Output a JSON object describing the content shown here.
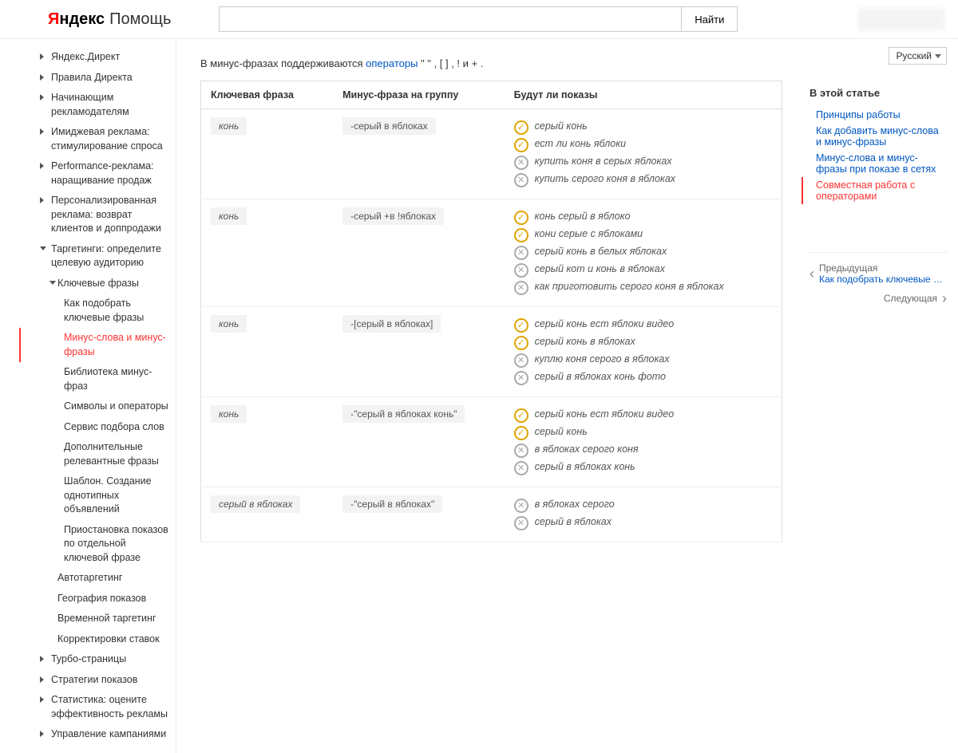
{
  "header": {
    "logo_red": "Я",
    "logo_rest": "ндекс",
    "logo_help": "Помощь",
    "search_placeholder": "",
    "search_button": "Найти"
  },
  "sidebar": {
    "items": [
      {
        "label": "Яндекс.Директ",
        "type": "top"
      },
      {
        "label": "Правила Директа",
        "type": "top"
      },
      {
        "label": "Начинающим рекламодателям",
        "type": "top"
      },
      {
        "label": "Имиджевая реклама: стимулирование спроса",
        "type": "top"
      },
      {
        "label": "Performance-реклама: наращивание продаж",
        "type": "top"
      },
      {
        "label": "Персонализированная реклама: возврат клиентов и доппродажи",
        "type": "top"
      },
      {
        "label": "Таргетинги: определите целевую аудиторию",
        "type": "top",
        "open": true,
        "children": [
          {
            "label": "Ключевые фразы",
            "type": "top",
            "open": true,
            "children2": [
              {
                "label": "Как подобрать ключевые фразы"
              },
              {
                "label": "Минус-слова и минус-фразы",
                "active": true
              },
              {
                "label": "Библиотека минус-фраз"
              },
              {
                "label": "Символы и операторы"
              },
              {
                "label": "Сервис подбора слов"
              },
              {
                "label": "Дополнительные релевантные фразы"
              },
              {
                "label": "Шаблон. Создание однотипных объявлений"
              },
              {
                "label": "Приостановка показов по отдельной ключевой фразе"
              }
            ]
          },
          {
            "label": "Автотаргетинг"
          },
          {
            "label": "География показов"
          },
          {
            "label": "Временной таргетинг"
          },
          {
            "label": "Корректировки ставок"
          }
        ]
      },
      {
        "label": "Турбо-страницы",
        "type": "top"
      },
      {
        "label": "Стратегии показов",
        "type": "top"
      },
      {
        "label": "Статистика: оцените эффективность рекламы",
        "type": "top"
      },
      {
        "label": "Управление кампаниями",
        "type": "top"
      }
    ]
  },
  "content": {
    "intro_prefix": "В минус-фразах поддерживаются ",
    "intro_link": "операторы",
    "intro_suffix": " \" \" , [ ] , ! и + .",
    "table": {
      "headers": [
        "Ключевая фраза",
        "Минус-фраза на группу",
        "Будут ли показы"
      ],
      "rows": [
        {
          "key": "конь",
          "minus": "-серый в яблоках",
          "results": [
            {
              "ok": true,
              "text": "серый конь"
            },
            {
              "ok": true,
              "text": "ест ли конь яблоки"
            },
            {
              "ok": false,
              "text": "купить коня в серых яблоках"
            },
            {
              "ok": false,
              "text": "купить серого коня в яблоках"
            }
          ]
        },
        {
          "key": "конь",
          "minus": "-серый +в !яблоках",
          "results": [
            {
              "ok": true,
              "text": "конь серый в яблоко"
            },
            {
              "ok": true,
              "text": "кони серые с яблоками"
            },
            {
              "ok": false,
              "text": "серый конь в белых яблоках"
            },
            {
              "ok": false,
              "text": "серый кот и конь в яблоках"
            },
            {
              "ok": false,
              "text": "как приготовить серого коня в яблоках"
            }
          ]
        },
        {
          "key": "конь",
          "minus": "-[серый в яблоках]",
          "results": [
            {
              "ok": true,
              "text": "серый конь ест яблоки видео"
            },
            {
              "ok": true,
              "text": "серый конь в яблоках"
            },
            {
              "ok": false,
              "text": "куплю коня серого в яблоках"
            },
            {
              "ok": false,
              "text": "серый в яблоках конь фото"
            }
          ]
        },
        {
          "key": "конь",
          "minus": "-\"серый в яблоках конь\"",
          "results": [
            {
              "ok": true,
              "text": "серый конь ест яблоки видео"
            },
            {
              "ok": true,
              "text": "серый конь"
            },
            {
              "ok": false,
              "text": "в яблоках серого коня"
            },
            {
              "ok": false,
              "text": "серый в яблоках конь"
            }
          ]
        },
        {
          "key": "серый в яблоках",
          "minus": "-\"серый в яблоках\"",
          "results": [
            {
              "ok": false,
              "text": "в яблоках серого"
            },
            {
              "ok": false,
              "text": "серый в яблоках"
            }
          ]
        }
      ]
    }
  },
  "aside": {
    "language": "Русский",
    "toc_title": "В этой статье",
    "toc": [
      {
        "label": "Принципы работы"
      },
      {
        "label": "Как добавить минус-слова и минус-фразы"
      },
      {
        "label": "Минус-слова и минус-фразы при показе в сетях"
      },
      {
        "label": "Совместная работа с операторами",
        "current": true
      }
    ],
    "prev_label": "Предыдущая",
    "prev_title": "Как подобрать ключевые ф…",
    "next_label": "Следующая"
  }
}
